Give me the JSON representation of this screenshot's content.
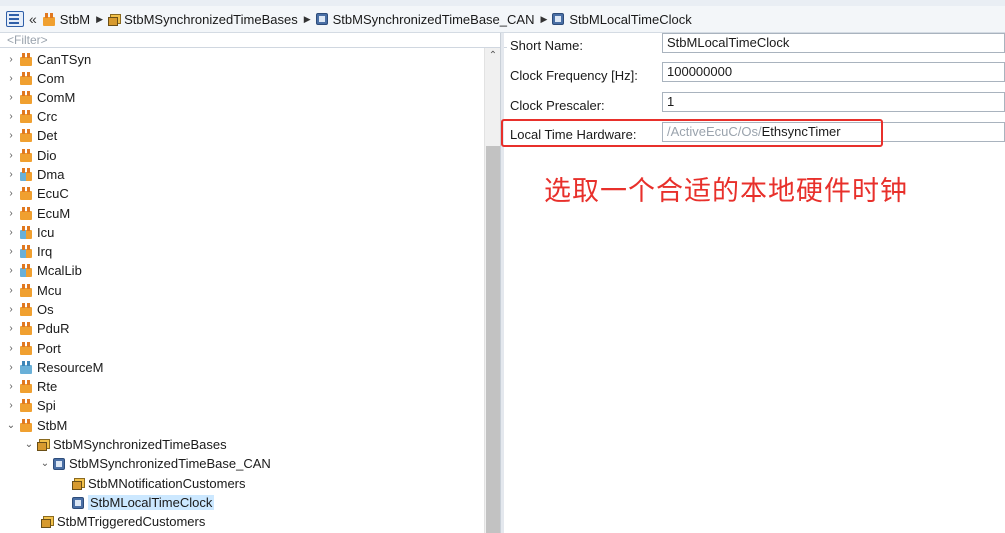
{
  "breadcrumb": {
    "items": [
      "StbM",
      "StbMSynchronizedTimeBases",
      "StbMSynchronizedTimeBase_CAN",
      "StbMLocalTimeClock"
    ]
  },
  "filter": {
    "placeholder": "<Filter>"
  },
  "tree": {
    "modules": [
      "CanTSyn",
      "Com",
      "ComM",
      "Crc",
      "Det",
      "Dio",
      "Dma",
      "EcuC",
      "EcuM",
      "Icu",
      "Irq",
      "McalLib",
      "Mcu",
      "Os",
      "PduR",
      "Port",
      "ResourceM",
      "Rte",
      "Spi"
    ],
    "stbm": {
      "label": "StbM",
      "synchronized_time_bases": "StbMSynchronizedTimeBases",
      "time_base_can": "StbMSynchronizedTimeBase_CAN",
      "notification_customers": "StbMNotificationCustomers",
      "local_time_clock": "StbMLocalTimeClock",
      "triggered_customers": "StbMTriggeredCustomers"
    }
  },
  "properties": {
    "short_name": {
      "label": "Short Name:",
      "value": "StbMLocalTimeClock"
    },
    "clock_frequency": {
      "label": "Clock Frequency [Hz]:",
      "value": "100000000"
    },
    "clock_prescaler": {
      "label": "Clock Prescaler:",
      "value": "1"
    },
    "local_time_hardware": {
      "label": "Local Time Hardware:",
      "path_prefix": "/ActiveEcuC/Os/",
      "path_name": "EthsyncTimer"
    }
  },
  "annotation": {
    "text": "选取一个合适的本地硬件时钟",
    "color": "#e8302b"
  },
  "colors": {
    "selection": "#cce8ff",
    "highlight_border": "#e8302b",
    "module_icon": "#f0a030",
    "module_icon_blue": "#69b0d8"
  }
}
